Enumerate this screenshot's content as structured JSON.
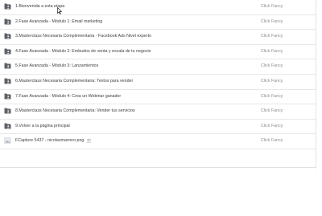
{
  "files": [
    {
      "name": "1.Bienvenida a esta etapa",
      "owner": "Click Fancy",
      "icon": "shared-folder-icon"
    },
    {
      "name": "2.Fase Avanzada - Módulo 1: Email marketing",
      "owner": "Click Fancy",
      "icon": "shared-folder-icon"
    },
    {
      "name": "3.Masterclass Necesaria Complementaria - Facebook Ads Nivel experto",
      "owner": "Click Fancy",
      "icon": "shared-folder-icon"
    },
    {
      "name": "4.Fase Avanzada - Módulo 2: Embudos de venta y escala de tu negocio",
      "owner": "Click Fancy",
      "icon": "shared-folder-icon"
    },
    {
      "name": "5.Fase Avanzada - Módulo 3: Lanzamientos",
      "owner": "Click Fancy",
      "icon": "shared-folder-icon"
    },
    {
      "name": "6.Masterclass Necesaria Complementaria: Textos para vender",
      "owner": "Click Fancy",
      "icon": "shared-folder-icon"
    },
    {
      "name": "7.Fase Avanzada - Módulo 4: Crea un Webinar ganador",
      "owner": "Click Fancy",
      "icon": "shared-folder-icon"
    },
    {
      "name": "8.Masterclass Necesaria Complementaria: Vender tus servicios",
      "owner": "Click Fancy",
      "icon": "shared-folder-icon"
    },
    {
      "name": "9.Volver a la página principal",
      "owner": "Click Fancy",
      "icon": "shared-folder-icon"
    },
    {
      "name": "FCapture 5437 - nicolasmarrero.png",
      "owner": "Click Fancy",
      "icon": "image-file-icon",
      "shared": true
    }
  ],
  "colors": {
    "folder": "#5f6368",
    "text": "#3c4043",
    "owner": "#8a8d91",
    "divider": "#e8e8e8"
  }
}
